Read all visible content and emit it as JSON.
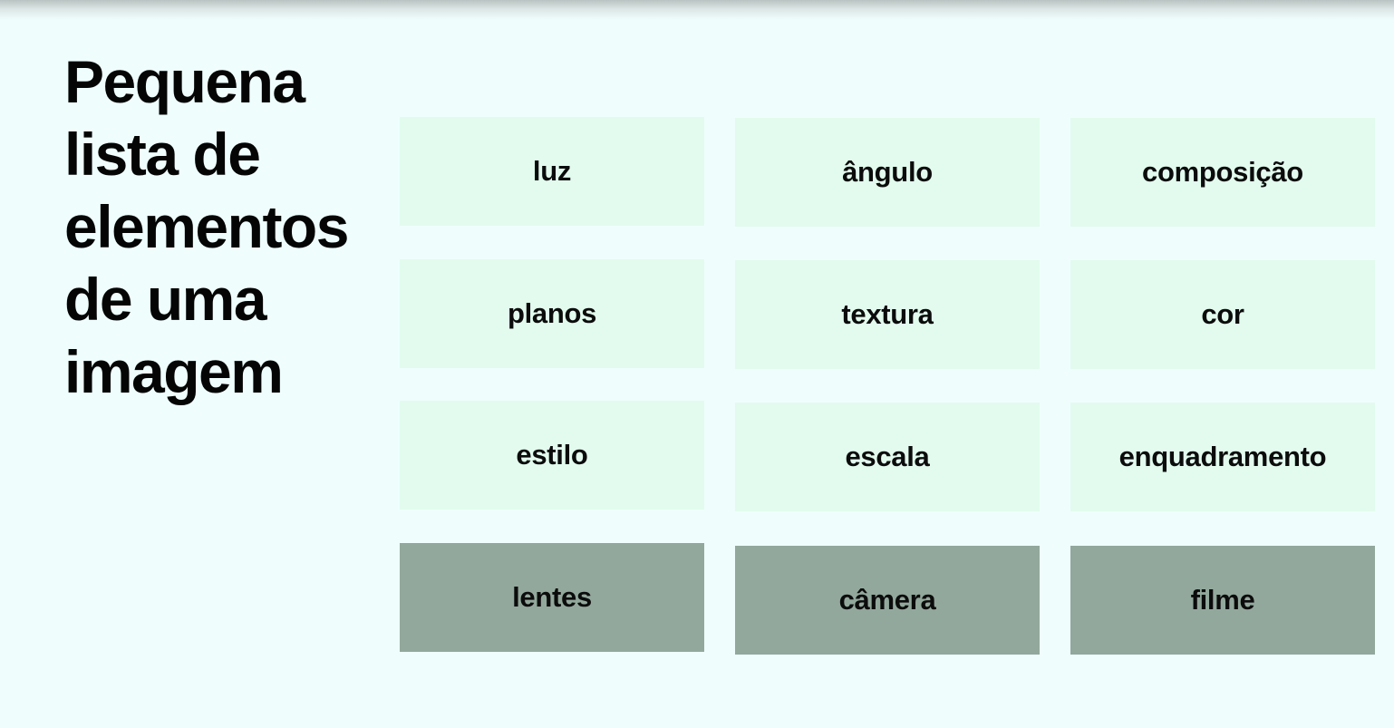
{
  "slide": {
    "title": "Pequena\nlista de\nelementos\nde uma\nimagem"
  },
  "tiles": [
    {
      "label": "luz",
      "variant": "light"
    },
    {
      "label": "ângulo",
      "variant": "light"
    },
    {
      "label": "composição",
      "variant": "light"
    },
    {
      "label": "planos",
      "variant": "light"
    },
    {
      "label": "textura",
      "variant": "light"
    },
    {
      "label": "cor",
      "variant": "light"
    },
    {
      "label": "estilo",
      "variant": "light"
    },
    {
      "label": "escala",
      "variant": "light"
    },
    {
      "label": "enquadramento",
      "variant": "light"
    },
    {
      "label": "lentes",
      "variant": "dark"
    },
    {
      "label": "câmera",
      "variant": "dark"
    },
    {
      "label": "filme",
      "variant": "dark"
    }
  ],
  "colors": {
    "background": "#effefd",
    "tile_light": "#e2fbee",
    "tile_dark": "#92a89c",
    "text": "#050505"
  }
}
